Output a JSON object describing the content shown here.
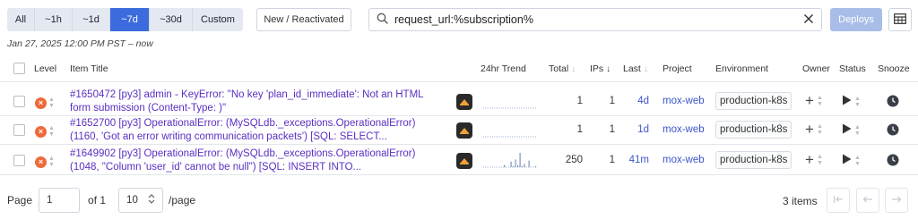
{
  "toolbar": {
    "time_ranges": [
      "All",
      "~1h",
      "~1d",
      "~7d",
      "~30d",
      "Custom"
    ],
    "active_range": "~7d",
    "new_reactivated_label": "New / Reactivated",
    "search_value": "request_url:%subscription%",
    "deploys_label": "Deploys"
  },
  "date_range": "Jan 27, 2025 12:00 PM PST – now",
  "columns": {
    "level": "Level",
    "item_title": "Item Title",
    "trend": "24hr Trend",
    "total": "Total",
    "ips": "IPs",
    "last": "Last",
    "project": "Project",
    "environment": "Environment",
    "owner": "Owner",
    "status": "Status",
    "snooze": "Snooze"
  },
  "rows": [
    {
      "title_line1": "#1650472 [py3] admin - KeyError: \"No key 'plan_id_immediate': Not an HTML",
      "title_line2": "form submission (Content-Type: )\"",
      "total": "1",
      "ips": "1",
      "last": "4d",
      "project": "mox-web",
      "environment": "production-k8s",
      "trend": [
        0,
        0,
        0,
        0,
        0,
        0,
        0,
        0,
        0,
        0,
        0,
        0,
        0,
        0,
        0,
        0,
        0,
        0,
        0,
        0,
        0,
        0,
        0,
        0
      ]
    },
    {
      "title_line1": "#1652700 [py3] OperationalError: (MySQLdb._exceptions.OperationalError)",
      "title_line2": "(1160, 'Got an error writing communication packets') [SQL: SELECT...",
      "total": "1",
      "ips": "1",
      "last": "1d",
      "project": "mox-web",
      "environment": "production-k8s",
      "trend": [
        0,
        0,
        0,
        0,
        0,
        0,
        0,
        0,
        0,
        0,
        0,
        0,
        0,
        0,
        0,
        0,
        0,
        0,
        0,
        0,
        0,
        0,
        0,
        0
      ]
    },
    {
      "title_line1": "#1649902 [py3] OperationalError: (MySQLdb._exceptions.OperationalError)",
      "title_line2": "(1048, \"Column 'user_id' cannot be null\") [SQL: INSERT INTO...",
      "total": "250",
      "ips": "1",
      "last": "41m",
      "project": "mox-web",
      "environment": "production-k8s",
      "trend": [
        0,
        0,
        0,
        0,
        0,
        0,
        0,
        0,
        0,
        2,
        0,
        0,
        5,
        1,
        7,
        2,
        13,
        1,
        3,
        0,
        6,
        0,
        0,
        1
      ]
    }
  ],
  "footer": {
    "page_label": "Page",
    "page_value": "1",
    "of_label": "of 1",
    "page_size": "10",
    "per_page_label": "/page",
    "items_count": "3 items"
  },
  "colors": {
    "accent": "#3b6bdc",
    "link": "#3b55c8",
    "title": "#5a2fc2",
    "error_level": "#ee6a3a",
    "deploys_disabled": "#a8bde8"
  },
  "icons": {
    "search": "search-icon",
    "clear": "close-icon",
    "table": "table-icon",
    "framework": "framework-icon",
    "owner": "plus-icon",
    "status": "play-icon",
    "snooze": "clock-icon"
  }
}
